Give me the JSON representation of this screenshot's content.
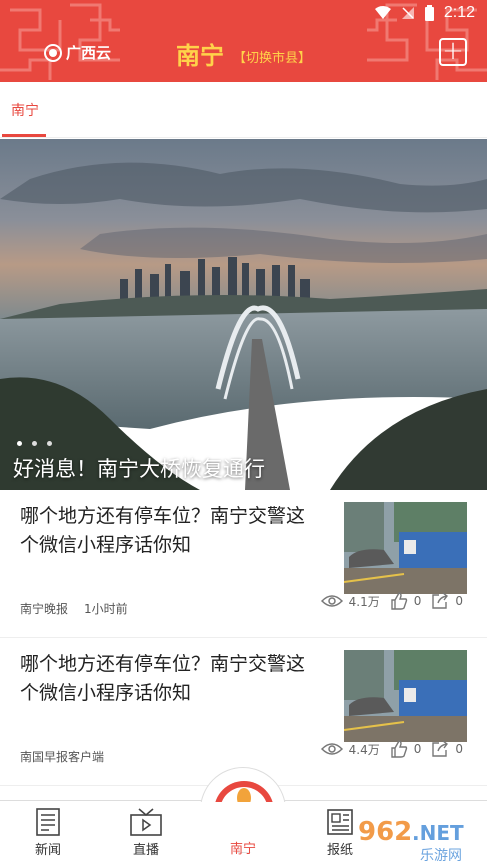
{
  "status_bar": {
    "time": "2:12"
  },
  "header": {
    "logo_text": "广西云",
    "city": "南宁",
    "switch_label": "【切换市县】"
  },
  "tabs": [
    {
      "label": "南宁",
      "active": true
    }
  ],
  "hero": {
    "caption": "好消息！南宁大桥恢复通行",
    "dots": 3,
    "active_dot": 0
  },
  "news": [
    {
      "title": "哪个地方还有停车位？南宁交警这个微信小程序话你知",
      "source": "南宁晚报",
      "time": "1小时前",
      "views": "4.1万",
      "likes": "0",
      "shares": "0"
    },
    {
      "title": "哪个地方还有停车位？南宁交警这个微信小程序话你知",
      "source": "南国早报客户端",
      "time": "",
      "views": "4.4万",
      "likes": "0",
      "shares": "0"
    }
  ],
  "bottom_nav": [
    {
      "label": "新闻",
      "icon": "news-icon"
    },
    {
      "label": "直播",
      "icon": "live-icon"
    },
    {
      "label": "南宁",
      "icon": "city-logo-icon",
      "active": true
    },
    {
      "label": "报纸",
      "icon": "newspaper-icon"
    }
  ],
  "watermark_text": "962.NET 乐游网",
  "colors": {
    "brand_red": "#e8483f",
    "accent_yellow": "#ffd24a"
  }
}
